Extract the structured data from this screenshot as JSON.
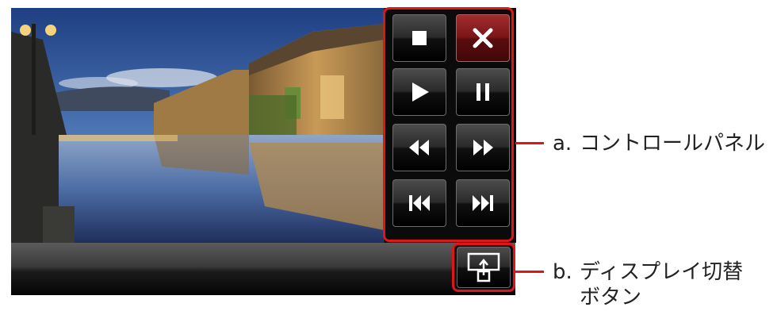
{
  "controls": {
    "stop": {
      "icon": "stop-icon"
    },
    "close": {
      "icon": "close-icon",
      "color": "#7a1518"
    },
    "play": {
      "icon": "play-icon"
    },
    "pause": {
      "icon": "pause-icon"
    },
    "rewind": {
      "icon": "rewind-icon"
    },
    "fast_forward": {
      "icon": "fast-forward-icon"
    },
    "previous": {
      "icon": "skip-previous-icon"
    },
    "next": {
      "icon": "skip-next-icon"
    }
  },
  "display_switch": {
    "icon": "display-switch-icon"
  },
  "callouts": {
    "a": {
      "marker": "a.",
      "label": "コントロールパネル"
    },
    "b": {
      "marker": "b.",
      "label_line1": "ディスプレイ切替",
      "label_line2": "ボタン"
    }
  },
  "colors": {
    "highlight": "#e0151a"
  }
}
